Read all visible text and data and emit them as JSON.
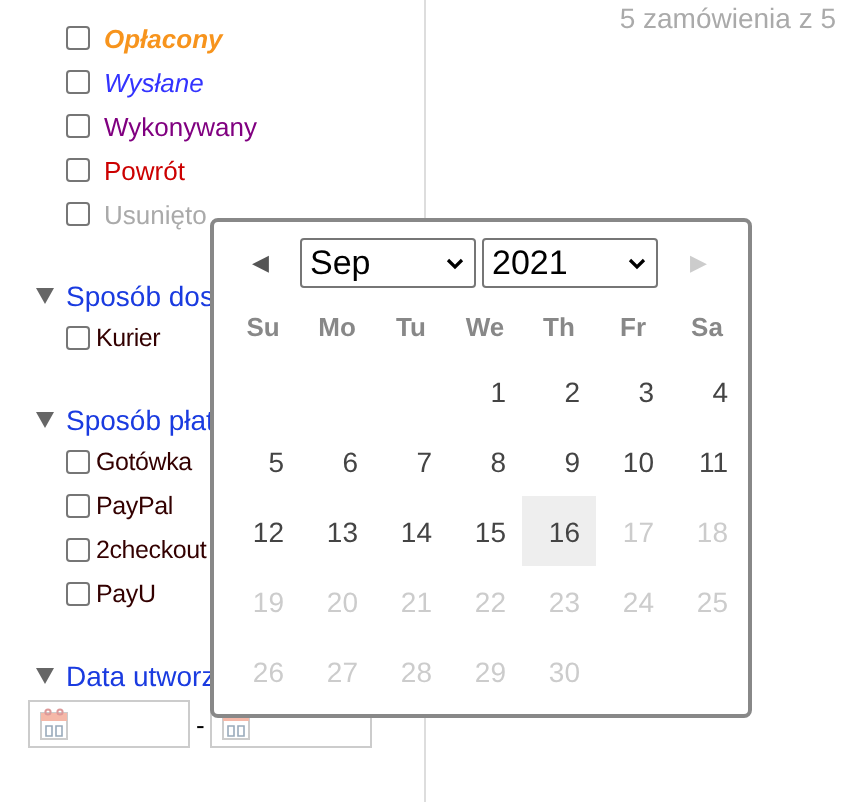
{
  "order_statuses": [
    {
      "label": "Opłacony",
      "checked": false,
      "color": "#f7941d",
      "kind": "bold-italic"
    },
    {
      "label": "Wysłane",
      "checked": false,
      "color": "#3333ff",
      "kind": "italic"
    },
    {
      "label": "Wykonywany",
      "checked": false,
      "color": "#800080",
      "kind": "plain"
    },
    {
      "label": "Powrót",
      "checked": false,
      "color": "#cc0000",
      "kind": "plain"
    },
    {
      "label": "Usunięto",
      "checked": false,
      "color": "#aaaaaa",
      "kind": "plain"
    }
  ],
  "sections": [
    {
      "title": "Sposób dos",
      "expanded": true,
      "options": [
        {
          "label": "Kurier",
          "checked": false
        }
      ]
    },
    {
      "title": "Sposób płat",
      "expanded": true,
      "options": [
        {
          "label": "Gotówka",
          "checked": false
        },
        {
          "label": "PayPal",
          "checked": false
        },
        {
          "label": "2checkout",
          "checked": false
        },
        {
          "label": "PayU",
          "checked": false
        }
      ]
    },
    {
      "title": "Data utworz",
      "expanded": true
    }
  ],
  "date_range": {
    "separator": "-"
  },
  "result_count": "5 zamówienia z 5",
  "datepicker": {
    "prev": "◀",
    "next": "▶",
    "next_disabled": true,
    "month": "Sep",
    "year": "2021",
    "weekdays": [
      "Su",
      "Mo",
      "Tu",
      "We",
      "Th",
      "Fr",
      "Sa"
    ],
    "weeks": [
      [
        {
          "kind": "empty"
        },
        {
          "kind": "empty"
        },
        {
          "kind": "empty"
        },
        {
          "kind": "day",
          "day": "1",
          "disabled": false,
          "selected": false
        },
        {
          "kind": "day",
          "day": "2",
          "disabled": false,
          "selected": false
        },
        {
          "kind": "day",
          "day": "3",
          "disabled": false,
          "selected": false
        },
        {
          "kind": "day",
          "day": "4",
          "disabled": false,
          "selected": false
        }
      ],
      [
        {
          "kind": "day",
          "day": "5",
          "disabled": false,
          "selected": false
        },
        {
          "kind": "day",
          "day": "6",
          "disabled": false,
          "selected": false
        },
        {
          "kind": "day",
          "day": "7",
          "disabled": false,
          "selected": false
        },
        {
          "kind": "day",
          "day": "8",
          "disabled": false,
          "selected": false
        },
        {
          "kind": "day",
          "day": "9",
          "disabled": false,
          "selected": false
        },
        {
          "kind": "day",
          "day": "10",
          "disabled": false,
          "selected": false
        },
        {
          "kind": "day",
          "day": "11",
          "disabled": false,
          "selected": false
        }
      ],
      [
        {
          "kind": "day",
          "day": "12",
          "disabled": false,
          "selected": false
        },
        {
          "kind": "day",
          "day": "13",
          "disabled": false,
          "selected": false
        },
        {
          "kind": "day",
          "day": "14",
          "disabled": false,
          "selected": false
        },
        {
          "kind": "day",
          "day": "15",
          "disabled": false,
          "selected": false
        },
        {
          "kind": "day",
          "day": "16",
          "disabled": false,
          "selected": true
        },
        {
          "kind": "day",
          "day": "17",
          "disabled": true,
          "selected": false
        },
        {
          "kind": "day",
          "day": "18",
          "disabled": true,
          "selected": false
        }
      ],
      [
        {
          "kind": "day",
          "day": "19",
          "disabled": true,
          "selected": false
        },
        {
          "kind": "day",
          "day": "20",
          "disabled": true,
          "selected": false
        },
        {
          "kind": "day",
          "day": "21",
          "disabled": true,
          "selected": false
        },
        {
          "kind": "day",
          "day": "22",
          "disabled": true,
          "selected": false
        },
        {
          "kind": "day",
          "day": "23",
          "disabled": true,
          "selected": false
        },
        {
          "kind": "day",
          "day": "24",
          "disabled": true,
          "selected": false
        },
        {
          "kind": "day",
          "day": "25",
          "disabled": true,
          "selected": false
        }
      ],
      [
        {
          "kind": "day",
          "day": "26",
          "disabled": true,
          "selected": false
        },
        {
          "kind": "day",
          "day": "27",
          "disabled": true,
          "selected": false
        },
        {
          "kind": "day",
          "day": "28",
          "disabled": true,
          "selected": false
        },
        {
          "kind": "day",
          "day": "29",
          "disabled": true,
          "selected": false
        },
        {
          "kind": "day",
          "day": "30",
          "disabled": true,
          "selected": false
        },
        {
          "kind": "empty"
        },
        {
          "kind": "empty"
        }
      ]
    ]
  }
}
